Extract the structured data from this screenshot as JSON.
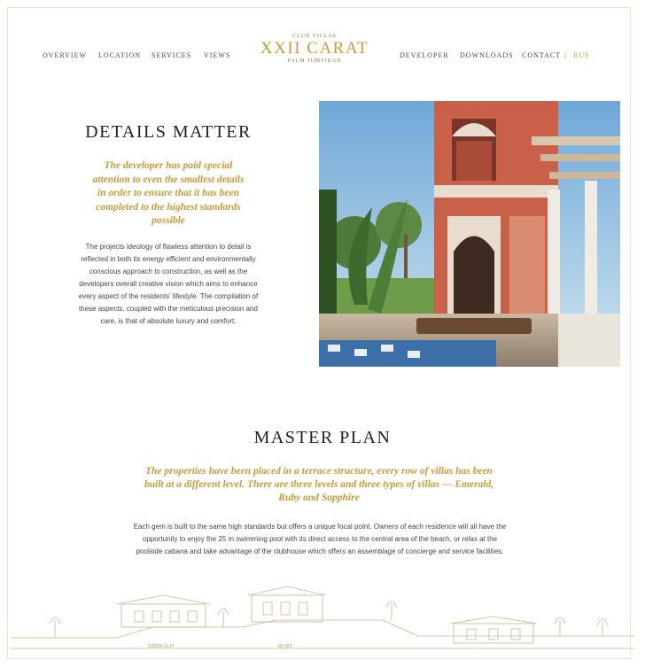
{
  "nav": {
    "left_items": [
      "OVERVIEW",
      "LOCATION",
      "SERVICES",
      "VIEWS"
    ],
    "right_items": [
      "DEVELOPER",
      "DOWNLOADS",
      "CONTACT"
    ],
    "separator": "|",
    "lang": "RUS"
  },
  "logo": {
    "top": "CLUB VILLAS",
    "main": "XXII CARAT",
    "bottom": "PALM JUMEIRAH"
  },
  "details": {
    "title": "DETAILS MATTER",
    "lead": "The developer has paid special attention to even the smallest details in order to ensure that it has been completed to the highest standards possible",
    "body": "The projects ideology of flawless attention to detail is reflected in both its energy efficient and environmentally conscious approach to construction, as well as the developers overall creative vision which aims to enhance every aspect of the residents' lifestyle. The compilation of these aspects, coupled with the meticulous precision and care, is that of absolute luxury and comfort."
  },
  "master_plan": {
    "title": "MASTER PLAN",
    "lead": "The properties have been placed in a terrace structure, every row of villas has been built at a different level. There are three levels and three types of villas — Emerald, Ruby and Sapphire",
    "body": "Each gem is built to the same high standards but offers a unique focal point. Owners of each residence will all have the opportunity to enjoy the 25 m swimming pool with its direct access to the central area of the beach, or relax at the poolside cabana and take advantage of the clubhouse which offers an assemblage of concierge and service facilities.",
    "labels": [
      "EMERALD",
      "RUBY"
    ]
  },
  "colors": {
    "gold": "#c99a3a",
    "border": "#efe3c7"
  }
}
